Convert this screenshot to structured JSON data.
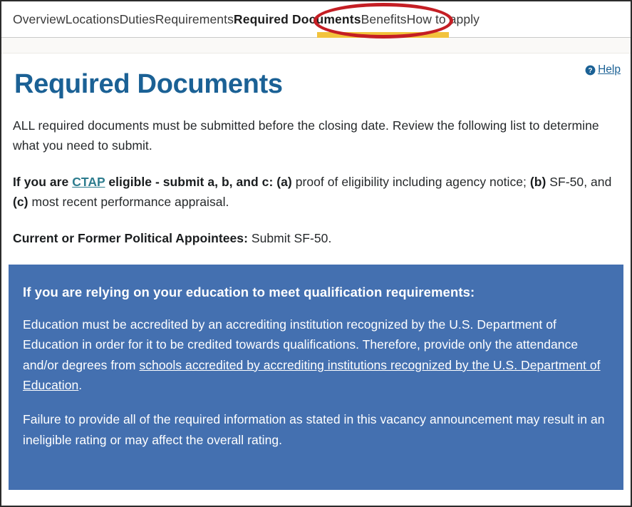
{
  "tabs": [
    {
      "label": "Overview",
      "active": false
    },
    {
      "label": "Locations",
      "active": false
    },
    {
      "label": "Duties",
      "active": false
    },
    {
      "label": "Requirements",
      "active": false
    },
    {
      "label": "Required Documents",
      "active": true
    },
    {
      "label": "Benefits",
      "active": false
    },
    {
      "label": "How to apply",
      "active": false
    }
  ],
  "help": {
    "label": "Help",
    "icon": "question-circle-icon"
  },
  "page": {
    "title": "Required Documents"
  },
  "intro": {
    "text": "ALL required documents must be submitted before the closing date. Review the following list to determine what you need to submit."
  },
  "ctap": {
    "lead": "If you are ",
    "link": "CTAP",
    "bold_mid": " eligible - submit a, b, and c: (a)",
    "plain_1": " proof of eligibility including agency notice; ",
    "bold_b": "(b)",
    "plain_2": " SF-50, and ",
    "bold_c": "(c)",
    "plain_3": " most recent performance appraisal."
  },
  "political": {
    "bold": "Current or Former Political Appointees:",
    "plain": " Submit SF-50."
  },
  "callout": {
    "heading": "If you are relying on your education to meet qualification requirements:",
    "para1_before": "Education must be accredited by an accrediting institution recognized by the U.S. Department of Education in order for it to be credited towards qualifications. Therefore, provide only the attendance and/or degrees from ",
    "para1_link": "schools accredited by accrediting institutions recognized by the U.S. Department of Education",
    "para1_after": ".",
    "para2": "Failure to provide all of the required information as stated in this vacancy announcement may result in an ineligible rating or may affect the overall rating."
  },
  "annotations": {
    "ellipse_target": "Required Documents",
    "ellipse_color": "#c41e24",
    "highlight_color": "#f2c33d"
  },
  "colors": {
    "title_blue": "#1b6195",
    "callout_blue": "#4470b0",
    "link_teal": "#2d7c8e",
    "body_text": "#26292b"
  }
}
